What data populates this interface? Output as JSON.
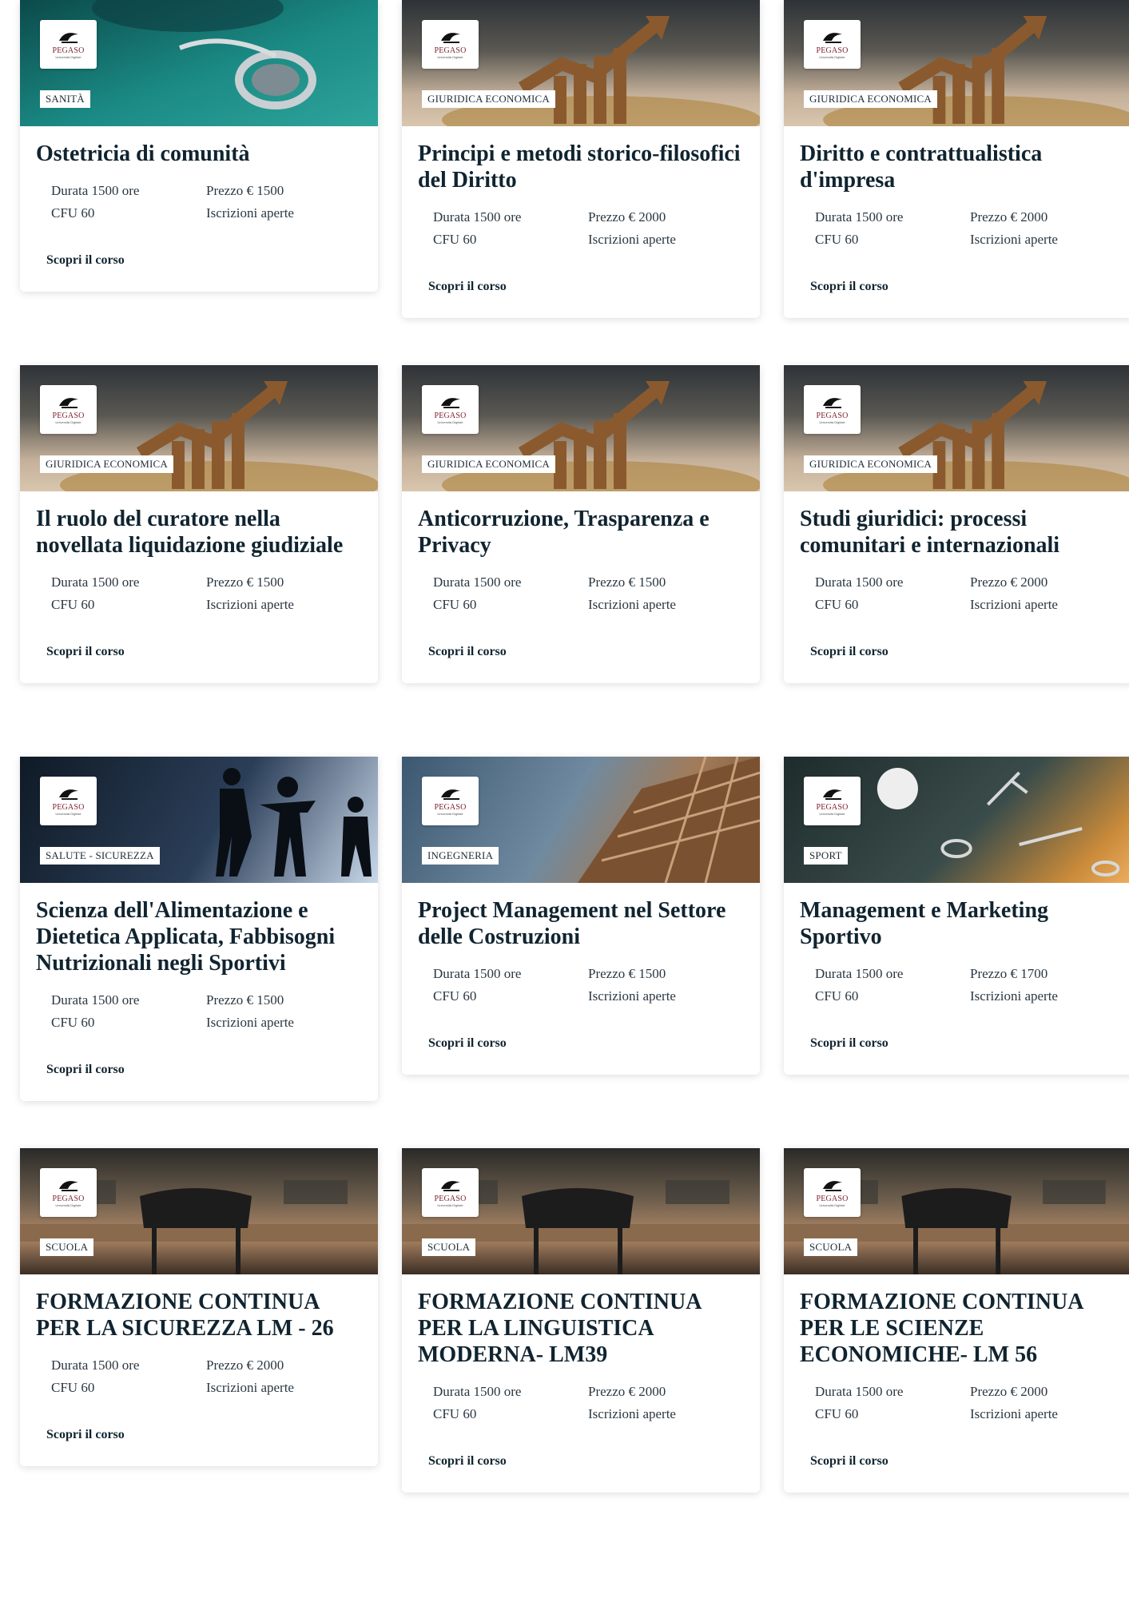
{
  "brand": {
    "logo_text": "PEGASO",
    "logo_subtext": "Università Digitale"
  },
  "labels": {
    "duration_prefix": "Durata",
    "cfu_prefix": "CFU",
    "price_prefix": "Prezzo",
    "cta": "Scopri il corso"
  },
  "courses": [
    {
      "tag": "SANITÀ",
      "title": "Ostetricia di comunità",
      "duration": "Durata 1500 ore",
      "cfu": "CFU 60",
      "price": "Prezzo € 1500",
      "status": "Iscrizioni aperte",
      "cta": "Scopri il corso"
    },
    {
      "tag": "GIURIDICA ECONOMICA",
      "title": "Principi e metodi storico-filosofici del Diritto",
      "duration": "Durata 1500 ore",
      "cfu": "CFU 60",
      "price": "Prezzo € 2000",
      "status": "Iscrizioni aperte",
      "cta": "Scopri il corso"
    },
    {
      "tag": "GIURIDICA ECONOMICA",
      "title": "Diritto e contrattualistica d'impresa",
      "duration": "Durata 1500 ore",
      "cfu": "CFU 60",
      "price": "Prezzo € 2000",
      "status": "Iscrizioni aperte",
      "cta": "Scopri il corso"
    },
    {
      "tag": "GIURIDICA ECONOMICA",
      "title": "Il ruolo del curatore nella novellata liquidazione giudiziale",
      "duration": "Durata 1500 ore",
      "cfu": "CFU 60",
      "price": "Prezzo € 1500",
      "status": "Iscrizioni aperte",
      "cta": "Scopri il corso"
    },
    {
      "tag": "GIURIDICA ECONOMICA",
      "title": "Anticorruzione, Trasparenza e Privacy",
      "duration": "Durata 1500 ore",
      "cfu": "CFU 60",
      "price": "Prezzo € 1500",
      "status": "Iscrizioni aperte",
      "cta": "Scopri il corso"
    },
    {
      "tag": "GIURIDICA ECONOMICA",
      "title": "Studi giuridici: processi comunitari e internazionali",
      "duration": "Durata 1500 ore",
      "cfu": "CFU 60",
      "price": "Prezzo € 2000",
      "status": "Iscrizioni aperte",
      "cta": "Scopri il corso"
    },
    {
      "tag": "SALUTE - SICUREZZA",
      "title": "Scienza dell'Alimentazione e Dietetica Applicata, Fabbisogni Nutrizionali negli Sportivi",
      "duration": "Durata 1500 ore",
      "cfu": "CFU 60",
      "price": "Prezzo € 1500",
      "status": "Iscrizioni aperte",
      "cta": "Scopri il corso"
    },
    {
      "tag": "INGEGNERIA",
      "title": "Project Management nel Settore delle Costruzioni",
      "duration": "Durata 1500 ore",
      "cfu": "CFU 60",
      "price": "Prezzo € 1500",
      "status": "Iscrizioni aperte",
      "cta": "Scopri il corso"
    },
    {
      "tag": "SPORT",
      "title": "Management e Marketing Sportivo",
      "duration": "Durata 1500 ore",
      "cfu": "CFU 60",
      "price": "Prezzo € 1700",
      "status": "Iscrizioni aperte",
      "cta": "Scopri il corso"
    },
    {
      "tag": "SCUOLA",
      "title": "FORMAZIONE CONTINUA PER LA SICUREZZA LM - 26",
      "duration": "Durata 1500 ore",
      "cfu": "CFU 60",
      "price": "Prezzo € 2000",
      "status": "Iscrizioni aperte",
      "cta": "Scopri il corso"
    },
    {
      "tag": "SCUOLA",
      "title": "FORMAZIONE CONTINUA PER LA LINGUISTICA MODERNA- LM39",
      "duration": "Durata 1500 ore",
      "cfu": "CFU 60",
      "price": "Prezzo € 2000",
      "status": "Iscrizioni aperte",
      "cta": "Scopri il corso"
    },
    {
      "tag": "SCUOLA",
      "title": "FORMAZIONE CONTINUA PER LE SCIENZE ECONOMICHE- LM 56",
      "duration": "Durata 1500 ore",
      "cfu": "CFU 60",
      "price": "Prezzo € 2000",
      "status": "Iscrizioni aperte",
      "cta": "Scopri il corso"
    }
  ]
}
